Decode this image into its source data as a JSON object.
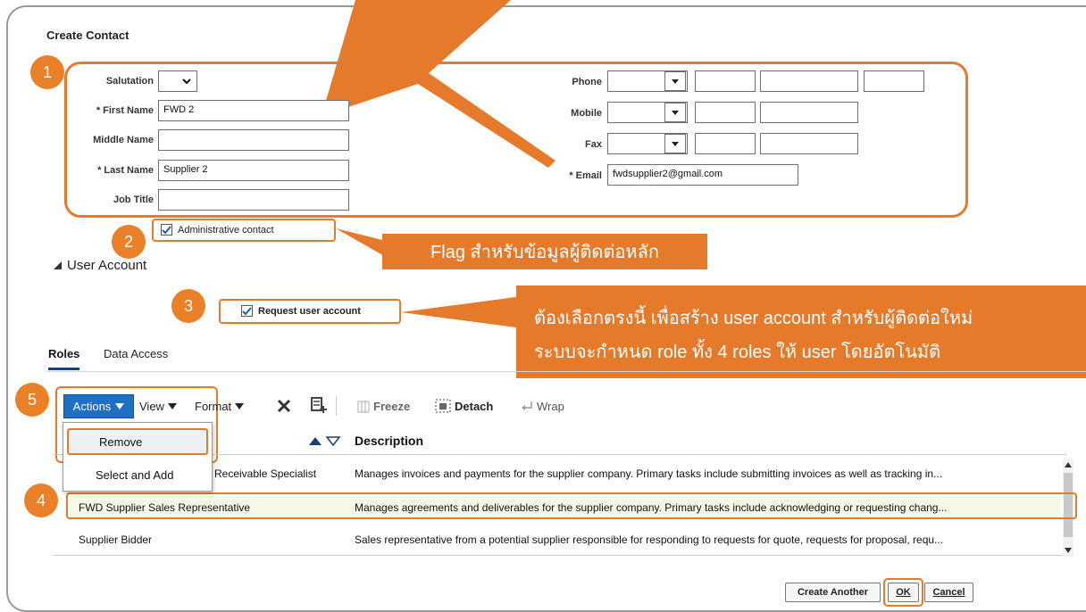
{
  "page": {
    "title": "Create Contact"
  },
  "form": {
    "salutation_label": "Salutation",
    "first_name_label": "First Name",
    "first_name_value": "FWD 2",
    "middle_name_label": "Middle Name",
    "last_name_label": "Last Name",
    "last_name_value": "Supplier 2",
    "job_title_label": "Job Title",
    "phone_label": "Phone",
    "mobile_label": "Mobile",
    "fax_label": "Fax",
    "email_label": "Email",
    "email_value": "fwdsupplier2@gmail.com",
    "required_marker": "*",
    "admin_contact_label": "Administrative contact",
    "admin_contact_checked": true
  },
  "user_account": {
    "section_title": "User Account",
    "request_label": "Request user account",
    "request_checked": true
  },
  "tabs": [
    {
      "label": "Roles",
      "active": true
    },
    {
      "label": "Data Access",
      "active": false
    }
  ],
  "toolbar": {
    "actions_label": "Actions",
    "view_label": "View",
    "format_label": "Format",
    "freeze_label": "Freeze",
    "detach_label": "Detach",
    "wrap_label": "Wrap"
  },
  "actions_menu": [
    {
      "label": "Remove",
      "highlighted": true
    },
    {
      "label": "Select and Add",
      "highlighted": false
    }
  ],
  "table": {
    "description_header": "Description",
    "rows": [
      {
        "role": "Receivable Specialist",
        "description": "Manages invoices and payments for the supplier company. Primary tasks include submitting invoices as well as tracking in..."
      },
      {
        "role": "FWD Supplier Sales Representative",
        "description": "Manages agreements and deliverables for the supplier company. Primary tasks include acknowledging or requesting chang..."
      },
      {
        "role": "Supplier Bidder",
        "description": "Sales representative from a potential supplier responsible for responding to requests for quote, requests for proposal, requ..."
      }
    ]
  },
  "buttons": {
    "create_another": "Create Another",
    "ok": "OK",
    "cancel": "Cancel"
  },
  "annotations": {
    "n1": "1",
    "n2": "2",
    "n3": "3",
    "n4": "4",
    "n5": "5",
    "flag_callout": "Flag สำหรับข้อมูลผู้ติดต่อหลัก",
    "account_callout_line1": "ต้องเลือกตรงนี้ เพื่อสร้าง user account สำหรับผู้ติดต่อใหม่",
    "account_callout_line2": "ระบบจะกำหนด role ทั้ง 4 roles ให้ user โดยอัตโนมัติ"
  },
  "colors": {
    "accent": "#e57a2b",
    "actions_btn": "#1f6fc5",
    "selected_row": "#f4f8e6"
  }
}
